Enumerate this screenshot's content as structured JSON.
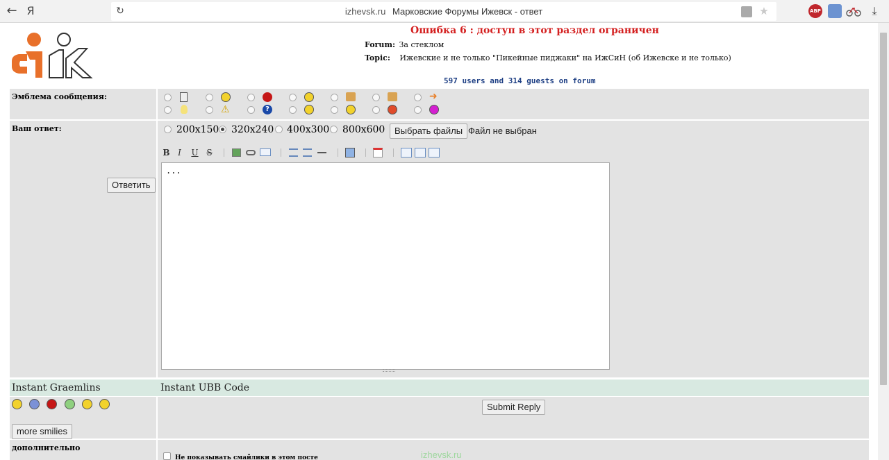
{
  "browser": {
    "back_glyph": "←",
    "yandex_glyph": "Я",
    "reload_glyph": "↻",
    "domain": "izhevsk.ru",
    "title": "Марковские Форумы Ижевск - ответ",
    "star_glyph": "★",
    "download_glyph": "⤓",
    "abp_label": "ABP"
  },
  "page": {
    "error_title": "Ошибка 6 : доступ в этот раздел ограничен",
    "forum_label": "Forum:",
    "forum_value": "За стеклом",
    "topic_label": "Topic:",
    "topic_value": "Ижевские и не только \"Пикейные пиджаки\" на ИжСиН (об Ижевске и не только)",
    "users_line": "597 users and 314 guests on forum"
  },
  "form": {
    "emblem_label": "Эмблема сообщения:",
    "reply_label": "Ваш ответ:",
    "answer_button": "Ответить",
    "sizes": [
      "200x150",
      "320x240",
      "400x300",
      "800x600"
    ],
    "selected_size": "320x240",
    "choose_files": "Выбрать файлы",
    "no_file": "Файл не выбран",
    "toolbar": {
      "bold": "B",
      "italic": "I",
      "underline": "U",
      "strike": "S"
    },
    "textarea_value": "...",
    "instant_graemlins": "Instant Graemlins",
    "instant_ubb": "Instant UBB Code",
    "submit": "Submit Reply",
    "more_smilies": "more smilies",
    "extra_label": "дополнительно",
    "no_smilies": "Не показывать смайлики в этом посте"
  },
  "watermark": "izhevsk.ru",
  "colors": {
    "error": "#d42020",
    "users": "#1e3f84",
    "logo_orange": "#e8702a",
    "row_bg": "#e3e3e3",
    "instant_bg": "#d8e9e1"
  }
}
